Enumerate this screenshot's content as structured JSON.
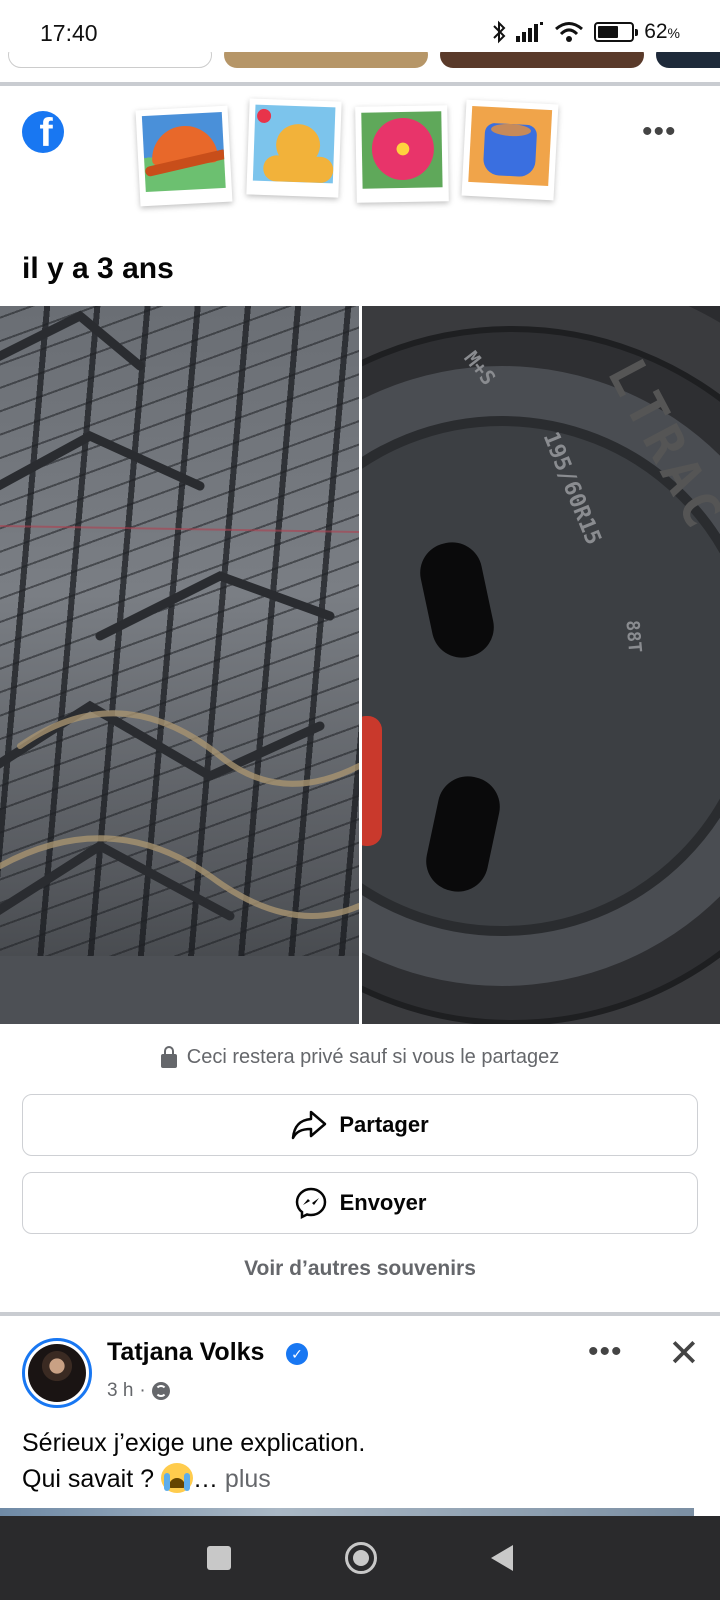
{
  "status_bar": {
    "time": "17:40",
    "battery": "62",
    "battery_suffix": "%",
    "icons": [
      "bluetooth-icon",
      "signal-icon",
      "wifi-icon",
      "battery-icon"
    ]
  },
  "memories": {
    "app_logo": "facebook-logo",
    "header_icons": [
      "hat-sticker-icon",
      "dog-sticker-icon",
      "flower-sticker-icon",
      "coffee-sticker-icon"
    ],
    "date_label": "il y a 3 ans",
    "photo_sidewall": {
      "ms_mark": "M+S",
      "size_code": "195/60R15",
      "load_index": "88T",
      "brand_fragment": "LTRAC"
    },
    "privacy_note": "Ceci restera privé sauf si vous le partagez",
    "share_label": "Partager",
    "send_label": "Envoyer",
    "see_more_label": "Voir d’autres souvenirs"
  },
  "post": {
    "author": "Tatjana Volks",
    "time": "3 h",
    "separator": "·",
    "text_line1": "Sérieux j’exige une explication.",
    "text_line2": "Qui savait ?",
    "ellipsis": "…",
    "more_label": "plus",
    "close": "✕"
  },
  "colors": {
    "facebook_blue": "#1877f2",
    "secondary_text": "#65676b",
    "border": "#ced0d4",
    "nav_bar": "#2a2a2c"
  }
}
